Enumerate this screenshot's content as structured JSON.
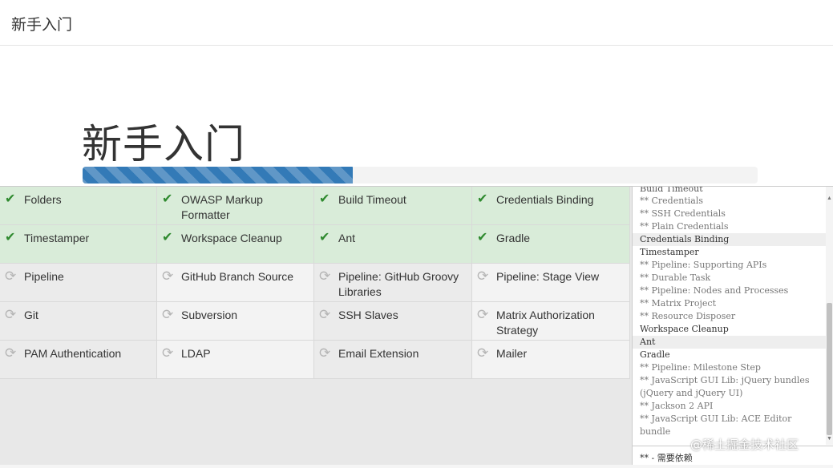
{
  "topbar": {
    "title": "新手入门"
  },
  "hero": {
    "heading": "新手入门",
    "progress": 0.4
  },
  "plugins": [
    {
      "label": "Folders",
      "status": "success",
      "icon": "check-icon"
    },
    {
      "label": "OWASP Markup Formatter",
      "status": "success",
      "icon": "check-icon"
    },
    {
      "label": "Build Timeout",
      "status": "success",
      "icon": "check-icon"
    },
    {
      "label": "Credentials Binding",
      "status": "success",
      "icon": "check-icon"
    },
    {
      "label": "Timestamper",
      "status": "success",
      "icon": "check-icon"
    },
    {
      "label": "Workspace Cleanup",
      "status": "success",
      "icon": "check-icon"
    },
    {
      "label": "Ant",
      "status": "success",
      "icon": "check-icon"
    },
    {
      "label": "Gradle",
      "status": "success",
      "icon": "check-icon"
    },
    {
      "label": "Pipeline",
      "status": "pending",
      "icon": "refresh-icon"
    },
    {
      "label": "GitHub Branch Source",
      "status": "pending",
      "icon": "refresh-icon"
    },
    {
      "label": "Pipeline: GitHub Groovy Libraries",
      "status": "pending",
      "icon": "refresh-icon"
    },
    {
      "label": "Pipeline: Stage View",
      "status": "pending",
      "icon": "refresh-icon"
    },
    {
      "label": "Git",
      "status": "pending",
      "icon": "refresh-icon"
    },
    {
      "label": "Subversion",
      "status": "pending",
      "icon": "refresh-icon"
    },
    {
      "label": "SSH Slaves",
      "status": "pending",
      "icon": "refresh-icon"
    },
    {
      "label": "Matrix Authorization Strategy",
      "status": "pending",
      "icon": "refresh-icon"
    },
    {
      "label": "PAM Authentication",
      "status": "pending",
      "icon": "refresh-icon"
    },
    {
      "label": "LDAP",
      "status": "pending",
      "icon": "refresh-icon"
    },
    {
      "label": "Email Extension",
      "status": "pending",
      "icon": "refresh-icon"
    },
    {
      "label": "Mailer",
      "status": "pending",
      "icon": "refresh-icon"
    }
  ],
  "log": {
    "cut_line": "Build Timeout",
    "lines": [
      {
        "text": "** Credentials",
        "type": "dep"
      },
      {
        "text": "** SSH Credentials",
        "type": "dep"
      },
      {
        "text": "** Plain Credentials",
        "type": "dep"
      },
      {
        "text": "Credentials Binding",
        "type": "plugin-hl"
      },
      {
        "text": "Timestamper",
        "type": "plugin"
      },
      {
        "text": "** Pipeline: Supporting APIs",
        "type": "dep"
      },
      {
        "text": "** Durable Task",
        "type": "dep"
      },
      {
        "text": "** Pipeline: Nodes and Processes",
        "type": "dep"
      },
      {
        "text": "** Matrix Project",
        "type": "dep"
      },
      {
        "text": "** Resource Disposer",
        "type": "dep"
      },
      {
        "text": "Workspace Cleanup",
        "type": "plugin"
      },
      {
        "text": "Ant",
        "type": "plugin-hl"
      },
      {
        "text": "Gradle",
        "type": "plugin"
      },
      {
        "text": "** Pipeline: Milestone Step",
        "type": "dep"
      },
      {
        "text": "** JavaScript GUI Lib: jQuery bundles (jQuery and jQuery UI)",
        "type": "dep"
      },
      {
        "text": "** Jackson 2 API",
        "type": "dep"
      },
      {
        "text": "** JavaScript GUI Lib: ACE Editor bundle",
        "type": "dep"
      }
    ],
    "footer": "** - 需要依赖"
  },
  "watermark": "@稀土掘金技术社区",
  "colors": {
    "accent": "#337ab7",
    "success_bg": "#d9ecd9",
    "check": "#2f8a2f"
  }
}
